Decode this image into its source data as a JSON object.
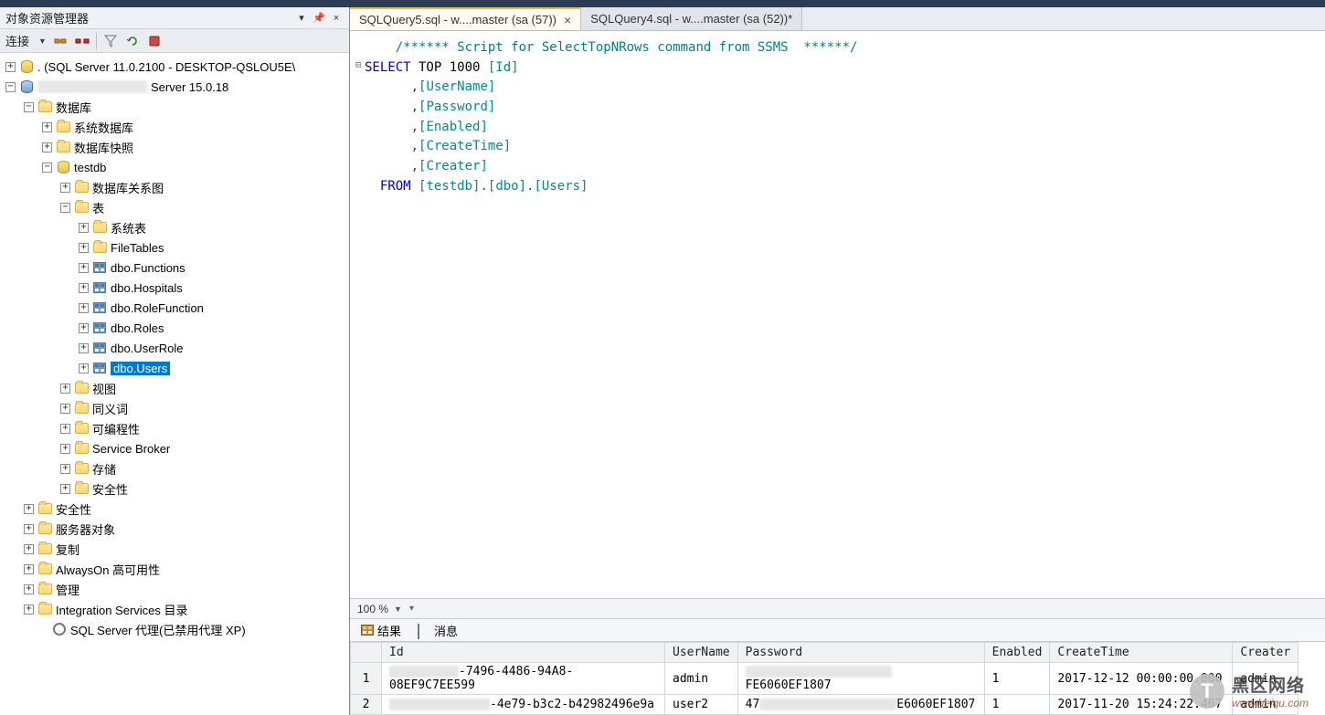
{
  "sidebar": {
    "title": "对象资源管理器",
    "connect_label": "连接",
    "servers": [
      {
        "label": ". (SQL Server 11.0.2100 - DESKTOP-QSLOU5E\\"
      },
      {
        "label_suffix": "Server 15.0.18"
      }
    ],
    "databases_label": "数据库",
    "sysdb_label": "系统数据库",
    "dbsnap_label": "数据库快照",
    "db_name": "testdb",
    "dbrel_label": "数据库关系图",
    "tables_label": "表",
    "systables_label": "系统表",
    "filetables_label": "FileTables",
    "tables": [
      "dbo.Functions",
      "dbo.Hospitals",
      "dbo.RoleFunction",
      "dbo.Roles",
      "dbo.UserRole",
      "dbo.Users"
    ],
    "views_label": "视图",
    "synonyms_label": "同义词",
    "programmability_label": "可编程性",
    "servicebroker_label": "Service Broker",
    "storage_label": "存储",
    "security_label": "安全性",
    "root_security_label": "安全性",
    "serverobjects_label": "服务器对象",
    "replication_label": "复制",
    "alwayson_label": "AlwaysOn 高可用性",
    "management_label": "管理",
    "integration_label": "Integration Services 目录",
    "agent_label": "SQL Server 代理(已禁用代理 XP)"
  },
  "tabs": [
    {
      "label": "SQLQuery5.sql - w....master (sa (57))",
      "active": true
    },
    {
      "label": "SQLQuery4.sql - w....master (sa (52))*",
      "active": false
    }
  ],
  "code": {
    "l1": "/****** Script for SelectTopNRows command from SSMS  ******/",
    "l2a": "SELECT",
    "l2b": " TOP ",
    "l2c": "1000",
    "l2d": " [Id]",
    "l3": ",[UserName]",
    "l4": ",[Password]",
    "l5": ",[Enabled]",
    "l6": ",[CreateTime]",
    "l7": ",[Creater]",
    "l8a": "  FROM ",
    "l8b": "[testdb]",
    "l8c": ".",
    "l8d": "[dbo]",
    "l8e": ".",
    "l8f": "[Users]"
  },
  "zoom": "100 %",
  "result_tabs": {
    "results": "结果",
    "messages": "消息"
  },
  "grid": {
    "columns": [
      "Id",
      "UserName",
      "Password",
      "Enabled",
      "CreateTime",
      "Creater"
    ],
    "rows": [
      {
        "n": "1",
        "id_suffix": "-7496-4486-94A8-08EF9C7EE599",
        "user": "admin",
        "pwd_suffix": "FE6060EF1807",
        "enabled": "1",
        "ctime": "2017-12-12 00:00:00.000",
        "creater": "admin"
      },
      {
        "n": "2",
        "id_mid": "-4e79-b3c2-b42982496e9a",
        "user": "user2",
        "pwd_prefix": "47",
        "pwd_suffix": "E6060EF1807",
        "enabled": "1",
        "ctime": "2017-11-20 15:24:22.467",
        "creater": "admin"
      }
    ]
  },
  "watermark": {
    "name": "黑区网络",
    "url": "www.heiqu.com"
  }
}
